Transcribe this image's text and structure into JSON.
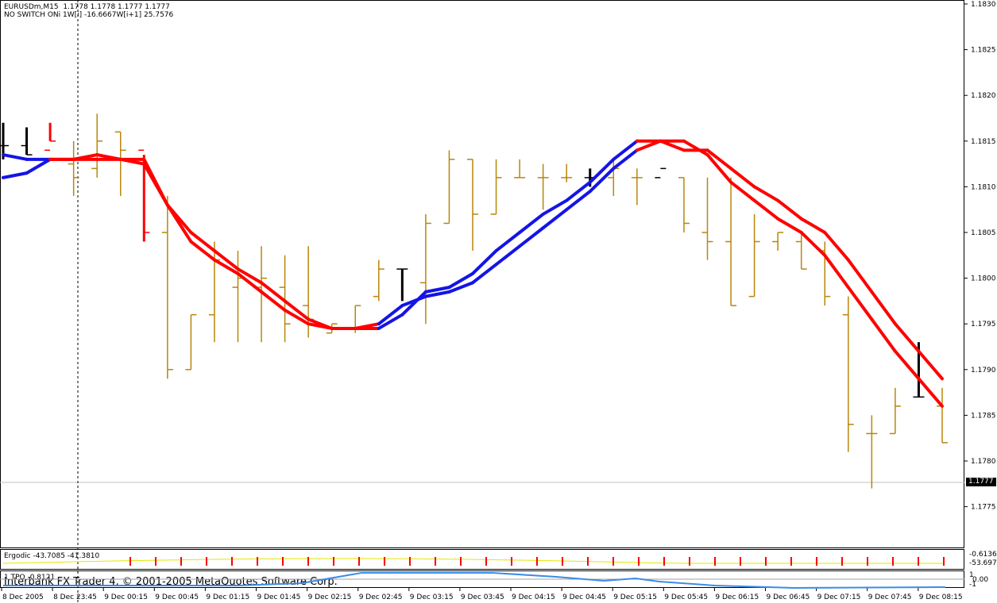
{
  "header": {
    "symbol_line": "EURUSDm,M15  1.1778 1.1778 1.1777 1.1777",
    "indicator_line": "NO SWITCH ONi 1W[i] -16.6667W[i+1] 25.7576"
  },
  "ergodic": {
    "label": "Ergodic -43.7085 -41.3810",
    "scale_top": "-0.6136",
    "scale_bottom": "-53.6971"
  },
  "tpo": {
    "label": "1 TPO -0.8121",
    "scale_top": "1",
    "scale_mid": "0.00",
    "scale_bottom": "-1"
  },
  "footer": {
    "watermark": "Interbank FX Trader 4, © 2001-2005 MetaQuotes Software Corp."
  },
  "current_price": "1.1777",
  "colors": {
    "bull_bar": "#b8860b",
    "ma_up": "#1414e6",
    "ma_down": "#ff0000",
    "neutral_bar": "#000000",
    "ergodic_line": "#e6e600",
    "tpo_line": "#3c8ce6"
  },
  "chart_data": {
    "type": "ohlc",
    "symbol": "EURUSDm",
    "timeframe": "M15",
    "y_ticks": [
      "1.1830",
      "1.1825",
      "1.1820",
      "1.1815",
      "1.1810",
      "1.1805",
      "1.1800",
      "1.1795",
      "1.1790",
      "1.1785",
      "1.1780",
      "1.1775"
    ],
    "ylim": [
      1.177,
      1.183
    ],
    "x_ticks": [
      "8 Dec 2005",
      "8 Dec 23:45",
      "9 Dec 00:15",
      "9 Dec 00:45",
      "9 Dec 01:15",
      "9 Dec 01:45",
      "9 Dec 02:15",
      "9 Dec 02:45",
      "9 Dec 03:15",
      "9 Dec 03:45",
      "9 Dec 04:15",
      "9 Dec 04:45",
      "9 Dec 05:15",
      "9 Dec 05:45",
      "9 Dec 06:15",
      "9 Dec 06:45",
      "9 Dec 07:15",
      "9 Dec 07:45",
      "9 Dec 08:15"
    ],
    "bars": [
      {
        "o": 1.18145,
        "h": 1.1817,
        "l": 1.1813,
        "c": 1.18145,
        "k": "neutral"
      },
      {
        "o": 1.18145,
        "h": 1.18165,
        "l": 1.18135,
        "c": 1.18135,
        "k": "neutral"
      },
      {
        "o": 1.1814,
        "h": 1.1817,
        "l": 1.1815,
        "c": 1.1815,
        "k": "down"
      },
      {
        "o": 1.18125,
        "h": 1.1815,
        "l": 1.1809,
        "c": 1.1811,
        "k": "bull"
      },
      {
        "o": 1.1812,
        "h": 1.1818,
        "l": 1.1811,
        "c": 1.1815,
        "k": "bull"
      },
      {
        "o": 1.1816,
        "h": 1.1816,
        "l": 1.1809,
        "c": 1.1814,
        "k": "bull"
      },
      {
        "o": 1.1814,
        "h": 1.18135,
        "l": 1.1804,
        "c": 1.1805,
        "k": "down"
      },
      {
        "o": 1.1805,
        "h": 1.1809,
        "l": 1.1789,
        "c": 1.179,
        "k": "bull"
      },
      {
        "o": 1.179,
        "h": 1.1796,
        "l": 1.179,
        "c": 1.1796,
        "k": "bull"
      },
      {
        "o": 1.1796,
        "h": 1.1804,
        "l": 1.1793,
        "c": 1.1802,
        "k": "bull"
      },
      {
        "o": 1.1799,
        "h": 1.1803,
        "l": 1.1793,
        "c": 1.18,
        "k": "bull"
      },
      {
        "o": 1.1799,
        "h": 1.18035,
        "l": 1.1793,
        "c": 1.18,
        "k": "bull"
      },
      {
        "o": 1.1799,
        "h": 1.18025,
        "l": 1.1793,
        "c": 1.1795,
        "k": "bull"
      },
      {
        "o": 1.1797,
        "h": 1.18035,
        "l": 1.17935,
        "c": 1.17955,
        "k": "bull"
      },
      {
        "o": 1.1794,
        "h": 1.1795,
        "l": 1.1794,
        "c": 1.1795,
        "k": "bull"
      },
      {
        "o": 1.17945,
        "h": 1.1797,
        "l": 1.1794,
        "c": 1.1797,
        "k": "bull"
      },
      {
        "o": 1.1798,
        "h": 1.1802,
        "l": 1.17975,
        "c": 1.1801,
        "k": "bull"
      },
      {
        "o": 1.1801,
        "h": 1.1801,
        "l": 1.17975,
        "c": 1.1801,
        "k": "neutral"
      },
      {
        "o": 1.17995,
        "h": 1.1807,
        "l": 1.1795,
        "c": 1.1806,
        "k": "bull"
      },
      {
        "o": 1.1806,
        "h": 1.1814,
        "l": 1.1806,
        "c": 1.1813,
        "k": "bull"
      },
      {
        "o": 1.1813,
        "h": 1.1813,
        "l": 1.1803,
        "c": 1.1807,
        "k": "bull"
      },
      {
        "o": 1.1807,
        "h": 1.1813,
        "l": 1.1807,
        "c": 1.1811,
        "k": "bull"
      },
      {
        "o": 1.1811,
        "h": 1.1813,
        "l": 1.1811,
        "c": 1.1811,
        "k": "bull"
      },
      {
        "o": 1.1811,
        "h": 1.18125,
        "l": 1.18075,
        "c": 1.1811,
        "k": "bull"
      },
      {
        "o": 1.1811,
        "h": 1.18125,
        "l": 1.18105,
        "c": 1.1811,
        "k": "bull"
      },
      {
        "o": 1.1811,
        "h": 1.1812,
        "l": 1.181,
        "c": 1.1811,
        "k": "neutral"
      },
      {
        "o": 1.1811,
        "h": 1.1813,
        "l": 1.1809,
        "c": 1.1812,
        "k": "bull"
      },
      {
        "o": 1.1811,
        "h": 1.1812,
        "l": 1.1808,
        "c": 1.1811,
        "k": "bull"
      },
      {
        "o": 1.1811,
        "h": 1.1812,
        "l": 1.1812,
        "c": 1.1812,
        "k": "neutral"
      },
      {
        "o": 1.1811,
        "h": 1.1811,
        "l": 1.1805,
        "c": 1.1806,
        "k": "bull"
      },
      {
        "o": 1.1805,
        "h": 1.1811,
        "l": 1.1802,
        "c": 1.1804,
        "k": "bull"
      },
      {
        "o": 1.1804,
        "h": 1.1811,
        "l": 1.1797,
        "c": 1.1797,
        "k": "bull"
      },
      {
        "o": 1.1798,
        "h": 1.1807,
        "l": 1.1798,
        "c": 1.1804,
        "k": "bull"
      },
      {
        "o": 1.1804,
        "h": 1.1805,
        "l": 1.1803,
        "c": 1.1805,
        "k": "bull"
      },
      {
        "o": 1.1804,
        "h": 1.1805,
        "l": 1.1801,
        "c": 1.1801,
        "k": "bull"
      },
      {
        "o": 1.1803,
        "h": 1.1804,
        "l": 1.1797,
        "c": 1.1798,
        "k": "bull"
      },
      {
        "o": 1.1796,
        "h": 1.1798,
        "l": 1.1781,
        "c": 1.1784,
        "k": "bull"
      },
      {
        "o": 1.1783,
        "h": 1.1785,
        "l": 1.1777,
        "c": 1.1783,
        "k": "bull"
      },
      {
        "o": 1.1783,
        "h": 1.1788,
        "l": 1.1783,
        "c": 1.1786,
        "k": "bull"
      },
      {
        "o": 1.1787,
        "h": 1.1793,
        "l": 1.1787,
        "c": 1.1787,
        "k": "neutral"
      },
      {
        "o": 1.1786,
        "h": 1.1788,
        "l": 1.1782,
        "c": 1.1782,
        "k": "bull"
      }
    ],
    "ma_upper": [
      1.18135,
      1.1813,
      1.1813,
      1.1813,
      1.18135,
      1.1813,
      1.18125,
      1.1808,
      1.1804,
      1.1802,
      1.18005,
      1.17985,
      1.17965,
      1.1795,
      1.17945,
      1.17945,
      1.17945,
      1.1796,
      1.17985,
      1.1799,
      1.18005,
      1.1803,
      1.1805,
      1.1807,
      1.18085,
      1.18105,
      1.1813,
      1.1815,
      1.1815,
      1.1814,
      1.1814,
      1.1812,
      1.181,
      1.18085,
      1.18065,
      1.1805,
      1.1802,
      1.17985,
      1.1795,
      1.1792,
      1.1789
    ],
    "ma_lower": [
      1.1811,
      1.18115,
      1.1813,
      1.1813,
      1.1813,
      1.1813,
      1.1813,
      1.1808,
      1.1805,
      1.1803,
      1.1801,
      1.17995,
      1.17975,
      1.17955,
      1.17945,
      1.17945,
      1.1795,
      1.1797,
      1.1798,
      1.17985,
      1.17995,
      1.18015,
      1.18035,
      1.18055,
      1.18075,
      1.18095,
      1.1812,
      1.1814,
      1.1815,
      1.1815,
      1.18135,
      1.18105,
      1.18085,
      1.18065,
      1.1805,
      1.18025,
      1.1799,
      1.17955,
      1.1792,
      1.1789,
      1.1786
    ]
  }
}
